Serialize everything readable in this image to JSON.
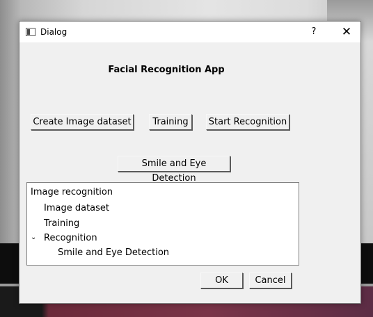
{
  "window": {
    "title": "Dialog",
    "help_label": "?",
    "close_label": "✕"
  },
  "app": {
    "title": "Facial Recognition App"
  },
  "buttons": {
    "create_dataset": "Create Image dataset",
    "training": "Training",
    "start_recognition": "Start Recognition",
    "smile_eye": "Smile and Eye Detection",
    "ok": "OK",
    "cancel": "Cancel"
  },
  "tree": {
    "root": "Image recognition",
    "items": [
      "Image dataset",
      "Training",
      "Recognition"
    ],
    "expanded_item_chevron": "⌄",
    "child": "Smile and Eye Detection"
  }
}
